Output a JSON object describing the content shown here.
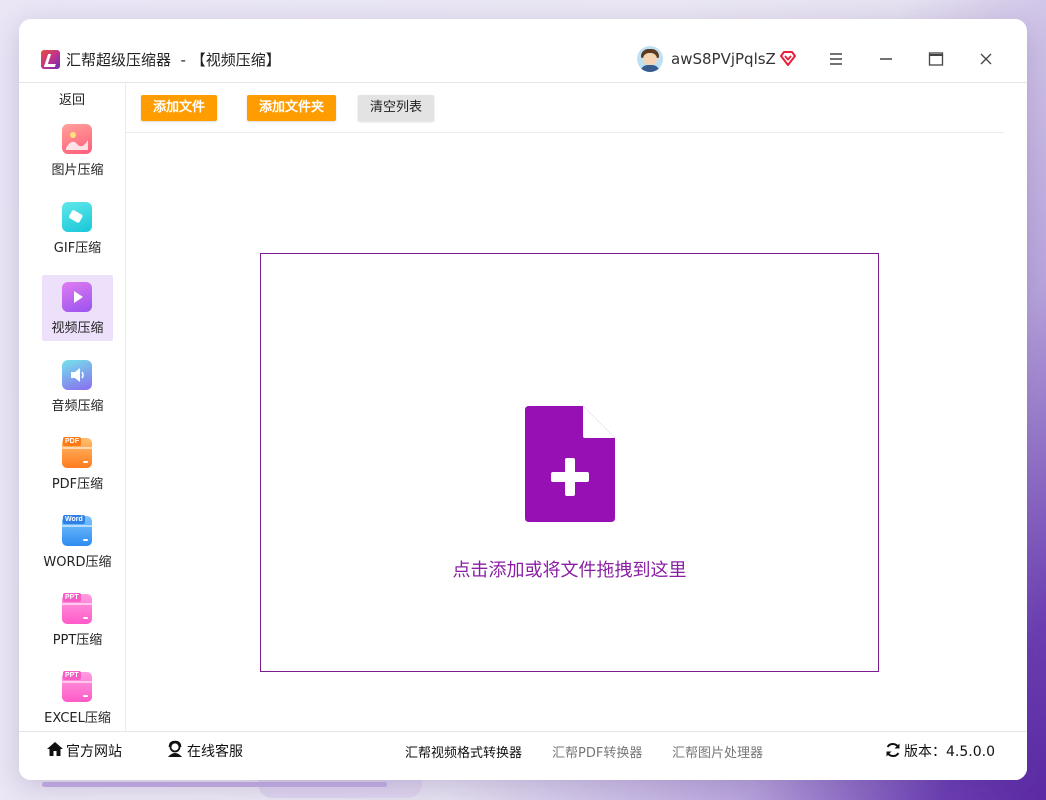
{
  "app": {
    "title": "汇帮超级压缩器  - 【视频压缩】",
    "username": "awS8PVjPqlsZ"
  },
  "window_controls": [
    "menu-icon",
    "minimize-icon",
    "maximize-icon",
    "close-icon"
  ],
  "sidebar": {
    "back_label": "返回",
    "items": [
      {
        "label": "图片压缩",
        "icon": "image-compress-icon"
      },
      {
        "label": "GIF压缩",
        "icon": "gif-compress-icon"
      },
      {
        "label": "视频压缩",
        "icon": "video-compress-icon",
        "active": true
      },
      {
        "label": "音频压缩",
        "icon": "audio-compress-icon"
      },
      {
        "label": "PDF压缩",
        "icon": "pdf-compress-icon",
        "tag": "PDF"
      },
      {
        "label": "WORD压缩",
        "icon": "word-compress-icon",
        "tag": "Word"
      },
      {
        "label": "PPT压缩",
        "icon": "ppt-compress-icon",
        "tag": "PPT"
      },
      {
        "label": "EXCEL压缩",
        "icon": "excel-compress-icon",
        "tag": "PPT"
      }
    ]
  },
  "toolbar": {
    "add_file": "添加文件",
    "add_folder": "添加文件夹",
    "clear_list": "清空列表"
  },
  "drop_zone": {
    "hint": "点击添加或将文件拖拽到这里"
  },
  "footer": {
    "website": "官方网站",
    "support": "在线客服",
    "link_video_converter": "汇帮视频格式转换器",
    "link_pdf_converter": "汇帮PDF转换器",
    "link_image_processor": "汇帮图片处理器",
    "version": "版本：4.5.0.0"
  },
  "colors": {
    "accent_orange": "#ff9c00",
    "drop_purple": "#8a1fa5",
    "active_bg": "#ece0fb"
  }
}
